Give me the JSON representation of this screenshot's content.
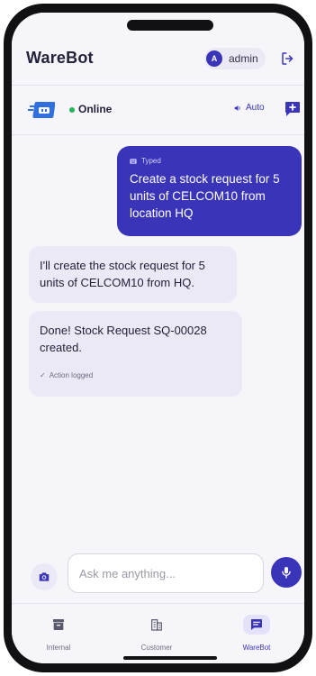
{
  "header": {
    "title": "WareBot",
    "user": {
      "initial": "A",
      "name": "admin"
    },
    "logout_icon": "logout-icon"
  },
  "status": {
    "state": "Online",
    "mode": "Auto",
    "speaker_icon": "speaker-icon",
    "new_chat_icon": "new-chat-icon"
  },
  "messages": [
    {
      "role": "user",
      "tag": "Typed",
      "text": "Create a stock request for 5 units of CELCOM10 from location HQ"
    },
    {
      "role": "bot",
      "text": "I'll create the stock request for 5 units of CELCOM10 from HQ."
    },
    {
      "role": "bot",
      "text": "Done! Stock Request SQ-00028 created.",
      "note": "Action logged"
    }
  ],
  "composer": {
    "placeholder": "Ask me anything...",
    "value": ""
  },
  "nav": {
    "items": [
      {
        "label": "Internal",
        "icon": "archive-box-icon"
      },
      {
        "label": "Customer",
        "icon": "building-icon"
      },
      {
        "label": "WareBot",
        "icon": "chat-icon",
        "active": true
      }
    ]
  },
  "colors": {
    "accent": "#3a35b8",
    "online": "#27b35a",
    "bot_bubble": "#ebe9f5",
    "background": "#f6f5fa"
  }
}
